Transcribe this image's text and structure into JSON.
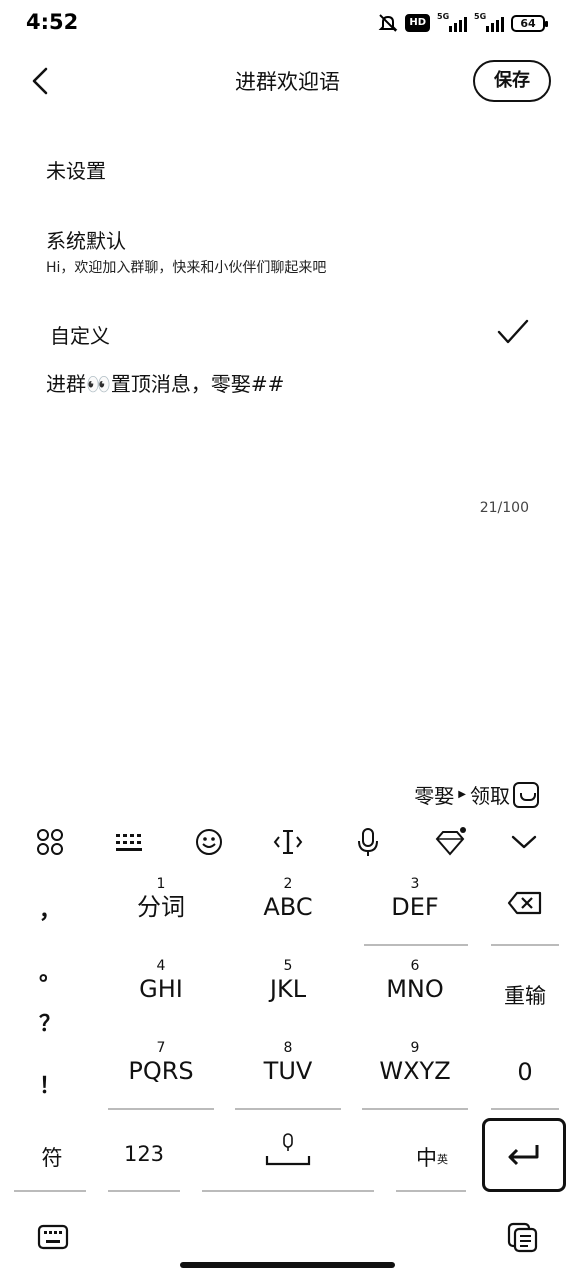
{
  "status_bar": {
    "time": "4:52",
    "hd": "HD",
    "network1": "5G",
    "network2": "5G",
    "battery": "64"
  },
  "header": {
    "back_icon": "chevron-left-icon",
    "title": "进群欢迎语",
    "save_label": "保存"
  },
  "options": {
    "unset": "未设置",
    "system_default": "系统默认",
    "system_default_text": "Hi，欢迎加入群聊，快来和小伙伴们聊起来吧",
    "custom": "自定义",
    "custom_selected": true
  },
  "editor": {
    "message": "进群👀置顶消息，零娶##",
    "counter": "21/100"
  },
  "promo": {
    "text1": "零娶",
    "text2": "领取"
  },
  "keyboard": {
    "toolbar": [
      "apps-icon",
      "keyboard-icon",
      "emoji-icon",
      "cursor-icon",
      "mic-icon",
      "skin-icon",
      "collapse-icon"
    ],
    "side_symbols": [
      "，",
      "。",
      "？",
      "！"
    ],
    "rows": [
      [
        {
          "num": "1",
          "main": "分词"
        },
        {
          "num": "2",
          "main": "ABC"
        },
        {
          "num": "3",
          "main": "DEF"
        }
      ],
      [
        {
          "num": "4",
          "main": "GHI"
        },
        {
          "num": "5",
          "main": "JKL"
        },
        {
          "num": "6",
          "main": "MNO"
        }
      ],
      [
        {
          "num": "7",
          "main": "PQRS"
        },
        {
          "num": "8",
          "main": "TUV"
        },
        {
          "num": "9",
          "main": "WXYZ"
        }
      ]
    ],
    "reinput": "重输",
    "zero": "0",
    "symbols": "符",
    "numbers": "123",
    "lang": "中",
    "lang_sub": "英"
  }
}
